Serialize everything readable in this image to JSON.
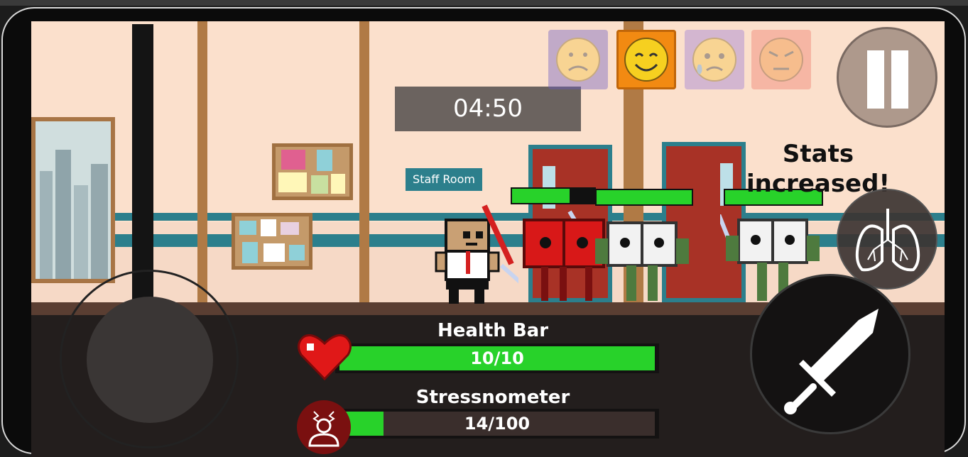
{
  "hud": {
    "timer": "04:50",
    "health_label": "Health Bar",
    "health_text": "10/10",
    "health_fraction": 1.0,
    "stress_label": "Stressnometer",
    "stress_text": "14/100",
    "stress_fraction": 0.14,
    "notification": "Stats increased!"
  },
  "scene": {
    "sign_text": "Staff Room"
  },
  "emotions": [
    {
      "name": "sad",
      "color": "#6b5cc4",
      "active": false
    },
    {
      "name": "happy",
      "color": "#f28a12",
      "active": true
    },
    {
      "name": "worried",
      "color": "#9a7ad6",
      "active": false
    },
    {
      "name": "angry",
      "color": "#f07a6a",
      "active": false
    }
  ],
  "enemies": [
    {
      "type": "red-book",
      "hp_fraction": 0.7
    },
    {
      "type": "white-book",
      "hp_fraction": 1.0
    },
    {
      "type": "white-book",
      "hp_fraction": 1.0
    }
  ],
  "icons": [
    "pause-icon",
    "lungs-icon",
    "sword-icon",
    "heart-icon",
    "stress-icon"
  ]
}
